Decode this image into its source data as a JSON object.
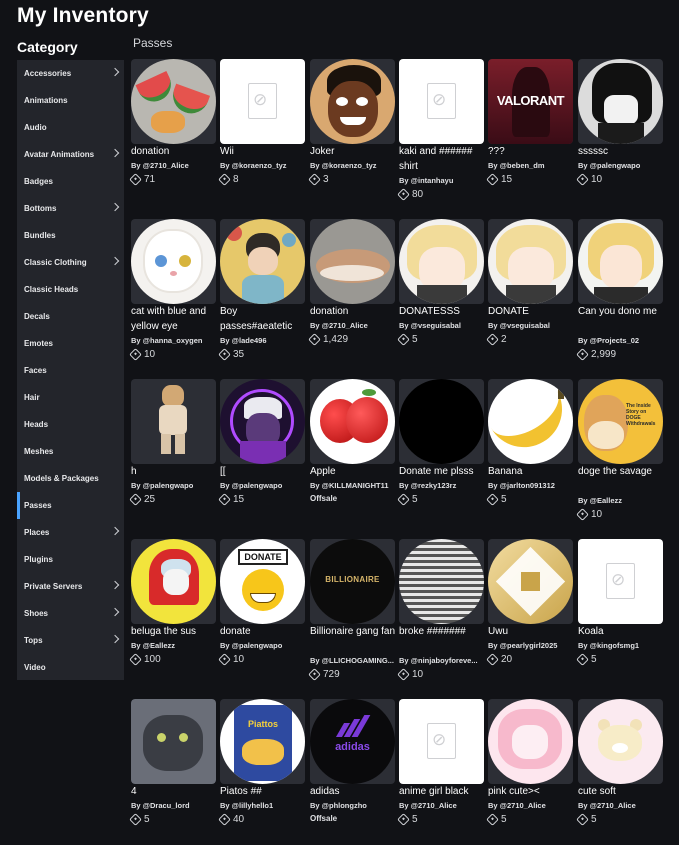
{
  "page_title": "My Inventory",
  "category_title": "Category",
  "section_title": "Passes",
  "sidebar": [
    {
      "label": "Accessories",
      "chevron": true
    },
    {
      "label": "Animations",
      "chevron": false
    },
    {
      "label": "Audio",
      "chevron": false
    },
    {
      "label": "Avatar Animations",
      "chevron": true
    },
    {
      "label": "Badges",
      "chevron": false
    },
    {
      "label": "Bottoms",
      "chevron": true
    },
    {
      "label": "Bundles",
      "chevron": false
    },
    {
      "label": "Classic Clothing",
      "chevron": true
    },
    {
      "label": "Classic Heads",
      "chevron": false
    },
    {
      "label": "Decals",
      "chevron": false
    },
    {
      "label": "Emotes",
      "chevron": false
    },
    {
      "label": "Faces",
      "chevron": false
    },
    {
      "label": "Hair",
      "chevron": false
    },
    {
      "label": "Heads",
      "chevron": false
    },
    {
      "label": "Meshes",
      "chevron": false
    },
    {
      "label": "Models & Packages",
      "chevron": false
    },
    {
      "label": "Passes",
      "chevron": false,
      "selected": true
    },
    {
      "label": "Places",
      "chevron": true
    },
    {
      "label": "Plugins",
      "chevron": false
    },
    {
      "label": "Private Servers",
      "chevron": true
    },
    {
      "label": "Shoes",
      "chevron": true
    },
    {
      "label": "Tops",
      "chevron": true
    },
    {
      "label": "Video",
      "chevron": false
    }
  ],
  "items": [
    {
      "name": "donation",
      "by": "By @2710_Alice",
      "price": "71",
      "lines": 1,
      "thumb": "watermelon"
    },
    {
      "name": "Wii",
      "by": "By @koraenzo_tyz",
      "price": "8",
      "lines": 1,
      "thumb": "placeholder"
    },
    {
      "name": "Joker",
      "by": "By @koraenzo_tyz",
      "price": "3",
      "lines": 1,
      "thumb": "joker"
    },
    {
      "name": "kaki and ###### shirt",
      "by": "By @intanhayu",
      "price": "80",
      "lines": 2,
      "thumb": "placeholder"
    },
    {
      "name": "???",
      "by": "By @beben_dm",
      "price": "15",
      "lines": 1,
      "thumb": "valorant"
    },
    {
      "name": "sssssc",
      "by": "By @palengwapo",
      "price": "10",
      "lines": 1,
      "thumb": "anime-dark"
    },
    {
      "name": "cat with blue and yellow eye",
      "by": "By @hanna_oxygen",
      "price": "10",
      "lines": 2,
      "thumb": "cat"
    },
    {
      "name": "Boy passes#aeatetic",
      "by": "By @lade496",
      "price": "35",
      "lines": 2,
      "thumb": "boy"
    },
    {
      "name": "donation",
      "by": "By @2710_Alice",
      "price": "1,429",
      "lines": 1,
      "thumb": "hamster"
    },
    {
      "name": "DONATESSS",
      "by": "By @vseguisabal",
      "price": "5",
      "lines": 1,
      "thumb": "blonde"
    },
    {
      "name": "DONATE",
      "by": "By @vseguisabal",
      "price": "2",
      "lines": 1,
      "thumb": "blonde"
    },
    {
      "name": "Can you dono me",
      "by": "By @Projects_02",
      "price": "2,999",
      "lines": 2,
      "thumb": "blonde2"
    },
    {
      "name": "h",
      "by": "By @palengwapo",
      "price": "25",
      "lines": 1,
      "thumb": "avatar"
    },
    {
      "name": "[[",
      "by": "By @palengwapo",
      "price": "15",
      "lines": 1,
      "thumb": "purple"
    },
    {
      "name": "Apple",
      "by": "By @KILLMANIGHT11",
      "price": null,
      "offsale": "Offsale",
      "lines": 1,
      "thumb": "apple"
    },
    {
      "name": "Donate me plsss",
      "by": "By @rezky123rz",
      "price": "5",
      "lines": 1,
      "thumb": "black"
    },
    {
      "name": "Banana",
      "by": "By @jarlton091312",
      "price": "5",
      "lines": 1,
      "thumb": "banana"
    },
    {
      "name": "doge the savage",
      "by": "By @Eallezz",
      "price": "10",
      "lines": 2,
      "thumb": "doge"
    },
    {
      "name": "beluga the sus",
      "by": "By @Eallezz",
      "price": "100",
      "lines": 1,
      "thumb": "beluga"
    },
    {
      "name": "donate",
      "by": "By @palengwapo",
      "price": "10",
      "lines": 1,
      "thumb": "donate"
    },
    {
      "name": "Billionaire gang fan",
      "by": "By @LLICHOGAMING...",
      "price": "729",
      "lines": 2,
      "thumb": "billionaire"
    },
    {
      "name": "broke #######",
      "by": "By @ninjaboyforeve...",
      "price": "10",
      "lines": 2,
      "thumb": "lines"
    },
    {
      "name": "Uwu",
      "by": "By @pearlygirl2025",
      "price": "20",
      "lines": 1,
      "thumb": "gold"
    },
    {
      "name": "Koala",
      "by": "By @kingofsmg1",
      "price": "5",
      "lines": 1,
      "thumb": "placeholder"
    },
    {
      "name": "4",
      "by": "By @Dracu_lord",
      "price": "5",
      "lines": 1,
      "thumb": "kitten"
    },
    {
      "name": "Piatos ##",
      "by": "By @lillyhello1",
      "price": "40",
      "lines": 1,
      "thumb": "piatos"
    },
    {
      "name": "adidas",
      "by": "By @phlongzho",
      "price": null,
      "offsale": "Offsale",
      "lines": 1,
      "thumb": "adidas"
    },
    {
      "name": "anime girl black",
      "by": "By @2710_Alice",
      "price": "5",
      "lines": 1,
      "thumb": "placeholder"
    },
    {
      "name": "pink cute><",
      "by": "By @2710_Alice",
      "price": "5",
      "lines": 1,
      "thumb": "pink"
    },
    {
      "name": "cute soft",
      "by": "By @2710_Alice",
      "price": "5",
      "lines": 1,
      "thumb": "bear"
    }
  ],
  "thumb_logos": {
    "valorant": "VALORANT",
    "donate": "DONATE",
    "billionaire": "BILLIONAIRE",
    "adidas": "adidas",
    "piatos": "Piattos",
    "doge": "The Inside Story on DOGE Withdrawals"
  }
}
